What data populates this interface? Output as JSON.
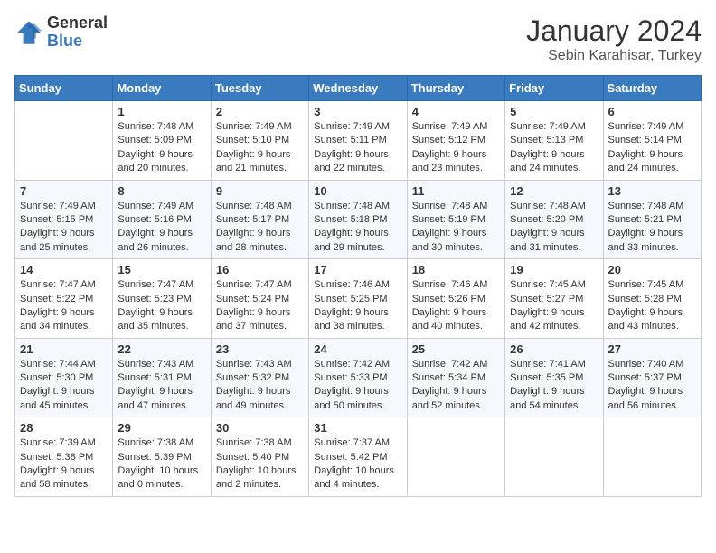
{
  "header": {
    "logo_general": "General",
    "logo_blue": "Blue",
    "month": "January 2024",
    "location": "Sebin Karahisar, Turkey"
  },
  "days_of_week": [
    "Sunday",
    "Monday",
    "Tuesday",
    "Wednesday",
    "Thursday",
    "Friday",
    "Saturday"
  ],
  "weeks": [
    [
      {
        "day": "",
        "sunrise": "",
        "sunset": "",
        "daylight": ""
      },
      {
        "day": "1",
        "sunrise": "Sunrise: 7:48 AM",
        "sunset": "Sunset: 5:09 PM",
        "daylight": "Daylight: 9 hours and 20 minutes."
      },
      {
        "day": "2",
        "sunrise": "Sunrise: 7:49 AM",
        "sunset": "Sunset: 5:10 PM",
        "daylight": "Daylight: 9 hours and 21 minutes."
      },
      {
        "day": "3",
        "sunrise": "Sunrise: 7:49 AM",
        "sunset": "Sunset: 5:11 PM",
        "daylight": "Daylight: 9 hours and 22 minutes."
      },
      {
        "day": "4",
        "sunrise": "Sunrise: 7:49 AM",
        "sunset": "Sunset: 5:12 PM",
        "daylight": "Daylight: 9 hours and 23 minutes."
      },
      {
        "day": "5",
        "sunrise": "Sunrise: 7:49 AM",
        "sunset": "Sunset: 5:13 PM",
        "daylight": "Daylight: 9 hours and 24 minutes."
      },
      {
        "day": "6",
        "sunrise": "Sunrise: 7:49 AM",
        "sunset": "Sunset: 5:14 PM",
        "daylight": "Daylight: 9 hours and 24 minutes."
      }
    ],
    [
      {
        "day": "7",
        "sunrise": "Sunrise: 7:49 AM",
        "sunset": "Sunset: 5:15 PM",
        "daylight": "Daylight: 9 hours and 25 minutes."
      },
      {
        "day": "8",
        "sunrise": "Sunrise: 7:49 AM",
        "sunset": "Sunset: 5:16 PM",
        "daylight": "Daylight: 9 hours and 26 minutes."
      },
      {
        "day": "9",
        "sunrise": "Sunrise: 7:48 AM",
        "sunset": "Sunset: 5:17 PM",
        "daylight": "Daylight: 9 hours and 28 minutes."
      },
      {
        "day": "10",
        "sunrise": "Sunrise: 7:48 AM",
        "sunset": "Sunset: 5:18 PM",
        "daylight": "Daylight: 9 hours and 29 minutes."
      },
      {
        "day": "11",
        "sunrise": "Sunrise: 7:48 AM",
        "sunset": "Sunset: 5:19 PM",
        "daylight": "Daylight: 9 hours and 30 minutes."
      },
      {
        "day": "12",
        "sunrise": "Sunrise: 7:48 AM",
        "sunset": "Sunset: 5:20 PM",
        "daylight": "Daylight: 9 hours and 31 minutes."
      },
      {
        "day": "13",
        "sunrise": "Sunrise: 7:48 AM",
        "sunset": "Sunset: 5:21 PM",
        "daylight": "Daylight: 9 hours and 33 minutes."
      }
    ],
    [
      {
        "day": "14",
        "sunrise": "Sunrise: 7:47 AM",
        "sunset": "Sunset: 5:22 PM",
        "daylight": "Daylight: 9 hours and 34 minutes."
      },
      {
        "day": "15",
        "sunrise": "Sunrise: 7:47 AM",
        "sunset": "Sunset: 5:23 PM",
        "daylight": "Daylight: 9 hours and 35 minutes."
      },
      {
        "day": "16",
        "sunrise": "Sunrise: 7:47 AM",
        "sunset": "Sunset: 5:24 PM",
        "daylight": "Daylight: 9 hours and 37 minutes."
      },
      {
        "day": "17",
        "sunrise": "Sunrise: 7:46 AM",
        "sunset": "Sunset: 5:25 PM",
        "daylight": "Daylight: 9 hours and 38 minutes."
      },
      {
        "day": "18",
        "sunrise": "Sunrise: 7:46 AM",
        "sunset": "Sunset: 5:26 PM",
        "daylight": "Daylight: 9 hours and 40 minutes."
      },
      {
        "day": "19",
        "sunrise": "Sunrise: 7:45 AM",
        "sunset": "Sunset: 5:27 PM",
        "daylight": "Daylight: 9 hours and 42 minutes."
      },
      {
        "day": "20",
        "sunrise": "Sunrise: 7:45 AM",
        "sunset": "Sunset: 5:28 PM",
        "daylight": "Daylight: 9 hours and 43 minutes."
      }
    ],
    [
      {
        "day": "21",
        "sunrise": "Sunrise: 7:44 AM",
        "sunset": "Sunset: 5:30 PM",
        "daylight": "Daylight: 9 hours and 45 minutes."
      },
      {
        "day": "22",
        "sunrise": "Sunrise: 7:43 AM",
        "sunset": "Sunset: 5:31 PM",
        "daylight": "Daylight: 9 hours and 47 minutes."
      },
      {
        "day": "23",
        "sunrise": "Sunrise: 7:43 AM",
        "sunset": "Sunset: 5:32 PM",
        "daylight": "Daylight: 9 hours and 49 minutes."
      },
      {
        "day": "24",
        "sunrise": "Sunrise: 7:42 AM",
        "sunset": "Sunset: 5:33 PM",
        "daylight": "Daylight: 9 hours and 50 minutes."
      },
      {
        "day": "25",
        "sunrise": "Sunrise: 7:42 AM",
        "sunset": "Sunset: 5:34 PM",
        "daylight": "Daylight: 9 hours and 52 minutes."
      },
      {
        "day": "26",
        "sunrise": "Sunrise: 7:41 AM",
        "sunset": "Sunset: 5:35 PM",
        "daylight": "Daylight: 9 hours and 54 minutes."
      },
      {
        "day": "27",
        "sunrise": "Sunrise: 7:40 AM",
        "sunset": "Sunset: 5:37 PM",
        "daylight": "Daylight: 9 hours and 56 minutes."
      }
    ],
    [
      {
        "day": "28",
        "sunrise": "Sunrise: 7:39 AM",
        "sunset": "Sunset: 5:38 PM",
        "daylight": "Daylight: 9 hours and 58 minutes."
      },
      {
        "day": "29",
        "sunrise": "Sunrise: 7:38 AM",
        "sunset": "Sunset: 5:39 PM",
        "daylight": "Daylight: 10 hours and 0 minutes."
      },
      {
        "day": "30",
        "sunrise": "Sunrise: 7:38 AM",
        "sunset": "Sunset: 5:40 PM",
        "daylight": "Daylight: 10 hours and 2 minutes."
      },
      {
        "day": "31",
        "sunrise": "Sunrise: 7:37 AM",
        "sunset": "Sunset: 5:42 PM",
        "daylight": "Daylight: 10 hours and 4 minutes."
      },
      {
        "day": "",
        "sunrise": "",
        "sunset": "",
        "daylight": ""
      },
      {
        "day": "",
        "sunrise": "",
        "sunset": "",
        "daylight": ""
      },
      {
        "day": "",
        "sunrise": "",
        "sunset": "",
        "daylight": ""
      }
    ]
  ]
}
